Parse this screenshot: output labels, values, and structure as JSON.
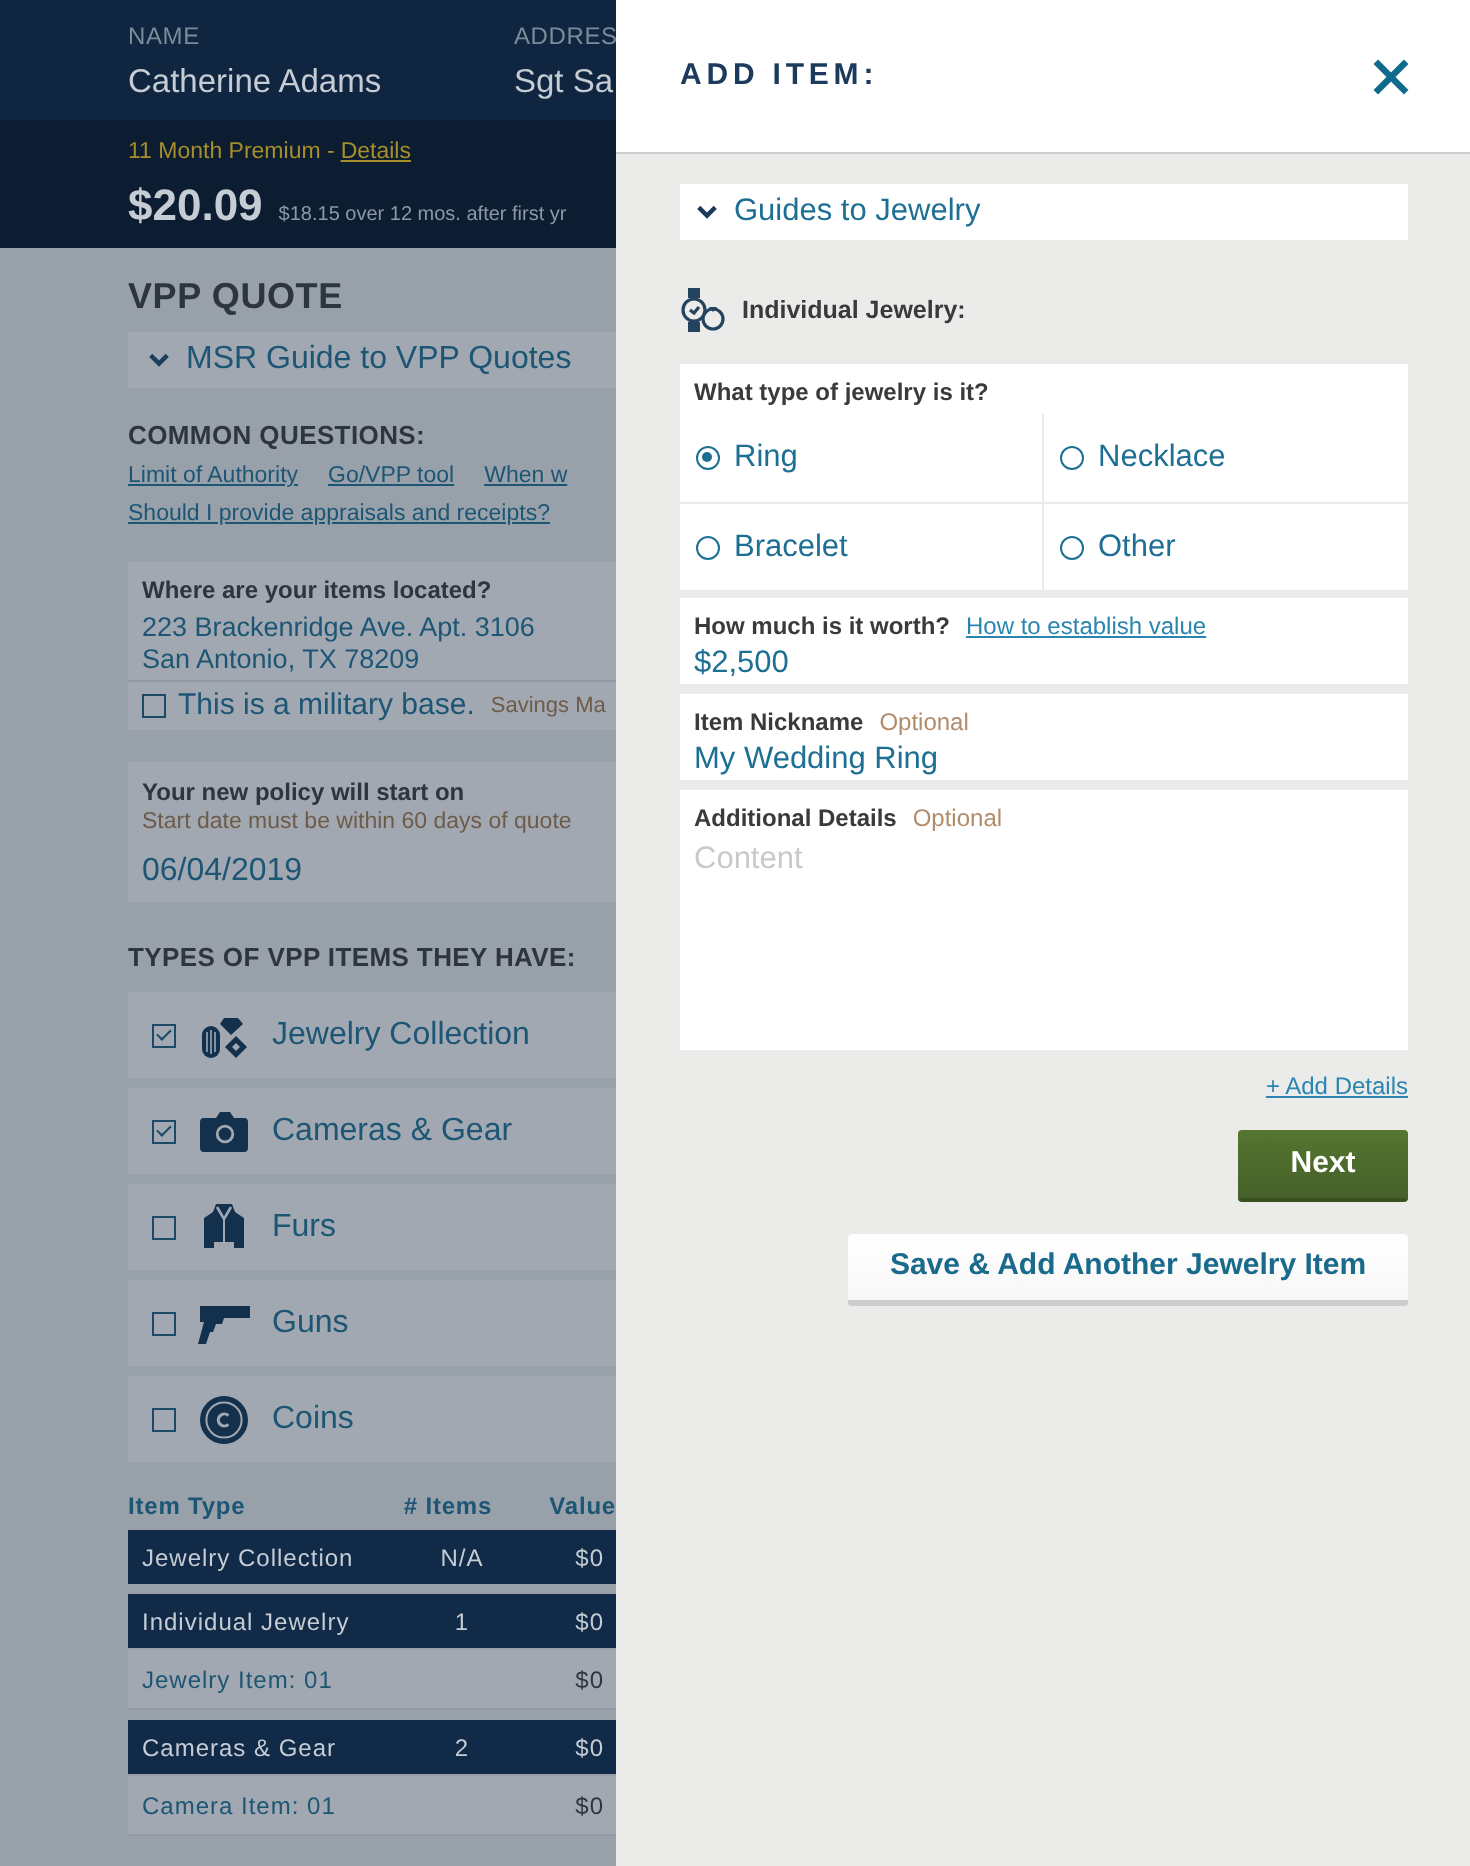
{
  "applicant": {
    "fields": [
      {
        "label": "NAME",
        "value": "Catherine Adams"
      },
      {
        "label": "ADDRES",
        "value": "Sgt Sa"
      }
    ]
  },
  "premium": {
    "label": "11 Month Premium -",
    "link": "Details",
    "amount": "$20.09",
    "note": "$18.15 over 12 mos. after first yr"
  },
  "quote": {
    "title": "VPP QUOTE",
    "guide": "MSR Guide to VPP Quotes"
  },
  "common_questions": {
    "title": "COMMON QUESTIONS:",
    "link_rows": [
      [
        "Limit of Authority",
        "Go/VPP tool",
        "When w"
      ],
      [
        "Should I provide appraisals and receipts?"
      ]
    ]
  },
  "location": {
    "label": "Where are your items located?",
    "address_lines": [
      "223 Brackenridge Ave. Apt. 3106",
      "San Antonio, TX 78209"
    ],
    "military_base": {
      "label": "This is a military base.",
      "checked": false,
      "note": "Savings Ma"
    }
  },
  "policy_start": {
    "label": "Your new policy will start on",
    "hint": "Start date must be within 60 days of quote",
    "value": "06/04/2019"
  },
  "item_types": {
    "title": "TYPES OF VPP ITEMS THEY HAVE:",
    "items": [
      {
        "kind": "gems",
        "label": "Jewelry Collection",
        "checked": true
      },
      {
        "kind": "camera",
        "label": "Cameras & Gear",
        "checked": true
      },
      {
        "kind": "coat",
        "label": "Furs",
        "checked": false
      },
      {
        "kind": "pistol",
        "label": "Guns",
        "checked": false
      },
      {
        "kind": "coin",
        "label": "Coins",
        "checked": false
      }
    ]
  },
  "summary_table": {
    "columns": [
      "Item Type",
      "# Items",
      "Value"
    ],
    "rows": [
      {
        "kind": "category",
        "item_type": "Jewelry Collection",
        "count": "N/A",
        "value": "$0"
      },
      {
        "kind": "category",
        "item_type": "Individual Jewelry",
        "count": "1",
        "value": "$0"
      },
      {
        "kind": "item",
        "item_type": "Jewelry Item: 01",
        "value": "$0"
      },
      {
        "kind": "category",
        "item_type": "Cameras & Gear",
        "count": "2",
        "value": "$0"
      },
      {
        "kind": "item",
        "item_type": "Camera Item: 01",
        "value": "$0"
      }
    ]
  },
  "add_item": {
    "title": "ADD ITEM:",
    "guide": "Guides to Jewelry",
    "section_title": "Individual Jewelry:",
    "jewelry_type": {
      "question": "What type of jewelry is it?",
      "options": [
        {
          "label": "Ring",
          "selected": true
        },
        {
          "label": "Necklace",
          "selected": false
        },
        {
          "label": "Bracelet",
          "selected": false
        },
        {
          "label": "Other",
          "selected": false
        }
      ]
    },
    "worth": {
      "label": "How much is it worth?",
      "help_link": "How to establish value",
      "value": "$2,500"
    },
    "nickname": {
      "label": "Item Nickname",
      "optional": "Optional",
      "value": "My Wedding Ring"
    },
    "details": {
      "label": "Additional Details",
      "optional": "Optional",
      "placeholder": "Content"
    },
    "add_details_link": "+ Add Details",
    "next_button": "Next",
    "save_another_button": "Save & Add Another Jewelry Item"
  }
}
